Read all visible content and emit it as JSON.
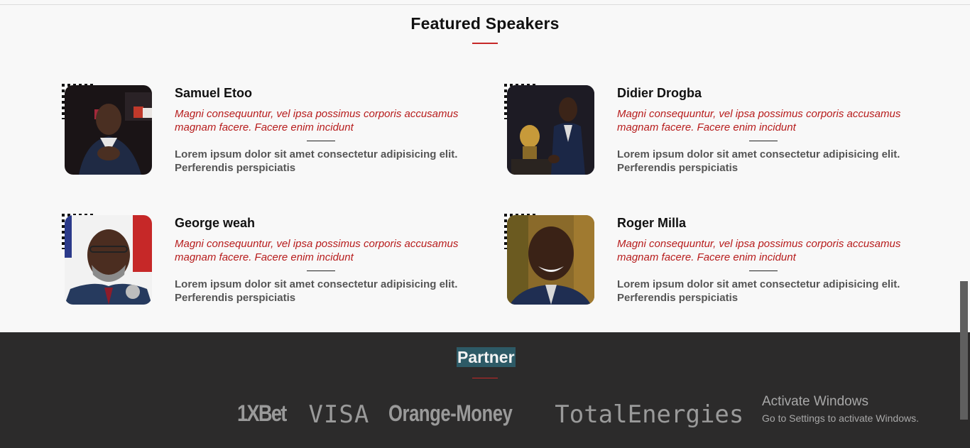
{
  "speakers_section": {
    "title": "Featured Speakers",
    "speakers": [
      {
        "name": "Samuel Etoo",
        "quote": "Magni consequuntur, vel ipsa possimus corporis accusamus magnam facere. Facere enim incidunt",
        "description": "Lorem ipsum dolor sit amet consectetur adipisicing elit. Perferendis perspiciatis"
      },
      {
        "name": "Didier Drogba",
        "quote": "Magni consequuntur, vel ipsa possimus corporis accusamus magnam facere. Facere enim incidunt",
        "description": "Lorem ipsum dolor sit amet consectetur adipisicing elit. Perferendis perspiciatis"
      },
      {
        "name": "George weah",
        "quote": "Magni consequuntur, vel ipsa possimus corporis accusamus magnam facere. Facere enim incidunt",
        "description": "Lorem ipsum dolor sit amet consectetur adipisicing elit. Perferendis perspiciatis"
      },
      {
        "name": "Roger Milla",
        "quote": "Magni consequuntur, vel ipsa possimus corporis accusamus magnam facere. Facere enim incidunt",
        "description": "Lorem ipsum dolor sit amet consectetur adipisicing elit. Perferendis perspiciatis"
      }
    ]
  },
  "partner_section": {
    "title": "Partner",
    "logos": [
      "1XBet",
      "VISA",
      "Orange-Money",
      "TotalEnergies"
    ]
  },
  "windows_watermark": {
    "title": "Activate Windows",
    "subtitle": "Go to Settings to activate Windows."
  },
  "colors": {
    "accent": "#c62828",
    "quote_text": "#b71c1c",
    "footer_bg": "#2c2b2b",
    "partner_highlight": "#2d5a66"
  }
}
